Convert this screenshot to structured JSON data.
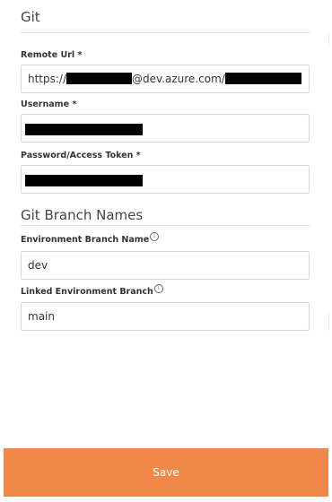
{
  "git_section": {
    "title": "Git"
  },
  "remote_url": {
    "label": "Remote Url *",
    "value_prefix": "https://",
    "value_middle": "@dev.azure.com/"
  },
  "username": {
    "label": "Username *"
  },
  "password": {
    "label": "Password/Access Token *"
  },
  "branches_section": {
    "title": "Git Branch Names"
  },
  "environment_branch": {
    "label": "Environment Branch Name",
    "value": "dev",
    "info_icon": "info-icon"
  },
  "linked_branch": {
    "label": "Linked Environment Branch",
    "value": "main",
    "info_icon": "info-icon"
  },
  "actions": {
    "save_label": "Save"
  },
  "colors": {
    "accent": "#f0884a",
    "border": "#d7d7d7",
    "text": "#333333"
  }
}
